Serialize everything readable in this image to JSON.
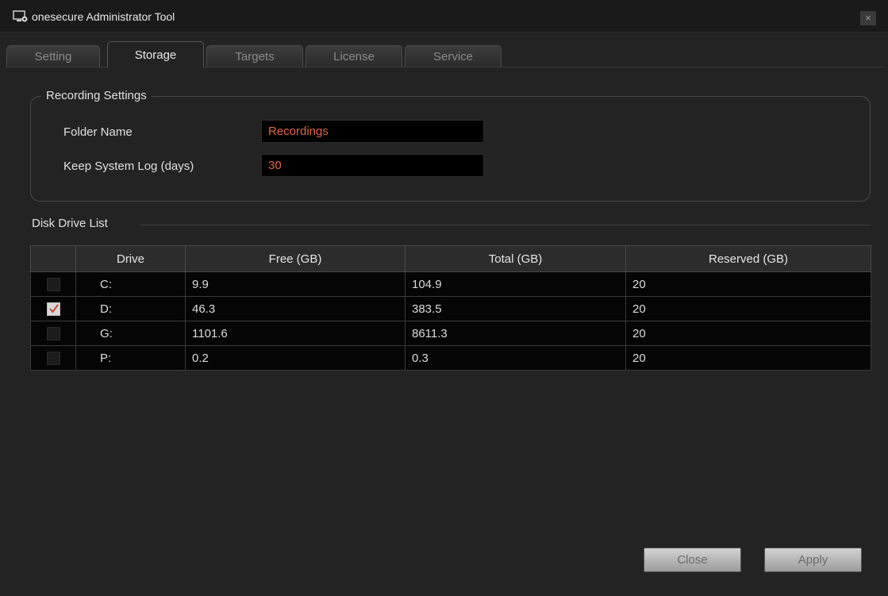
{
  "window": {
    "title": "onesecure Administrator Tool",
    "close_glyph": "×"
  },
  "tabs": [
    {
      "label": "Setting",
      "active": false
    },
    {
      "label": "Storage",
      "active": true
    },
    {
      "label": "Targets",
      "active": false
    },
    {
      "label": "License",
      "active": false
    },
    {
      "label": "Service",
      "active": false
    }
  ],
  "recording_settings": {
    "title": "Recording Settings",
    "folder_name_label": "Folder Name",
    "folder_name_value": "Recordings",
    "keep_log_label": "Keep System Log (days)",
    "keep_log_value": "30"
  },
  "disk_drive_list": {
    "title": "Disk Drive List",
    "columns": [
      "",
      "Drive",
      "Free (GB)",
      "Total (GB)",
      "Reserved (GB)"
    ],
    "rows": [
      {
        "checked": false,
        "drive": "C:",
        "free": "9.9",
        "total": "104.9",
        "reserved": "20"
      },
      {
        "checked": true,
        "drive": "D:",
        "free": "46.3",
        "total": "383.5",
        "reserved": "20"
      },
      {
        "checked": false,
        "drive": "G:",
        "free": "1101.6",
        "total": "8611.3",
        "reserved": "20"
      },
      {
        "checked": false,
        "drive": "P:",
        "free": "0.2",
        "total": "0.3",
        "reserved": "20"
      }
    ]
  },
  "buttons": {
    "close_label": "Close",
    "apply_label": "Apply"
  },
  "colors": {
    "accent_text": "#e0674a",
    "checkmark": "#c8472e"
  },
  "icons": {
    "app": "monitor-gear-icon",
    "window_close": "close-icon",
    "checkbox_check": "checkmark-icon"
  }
}
